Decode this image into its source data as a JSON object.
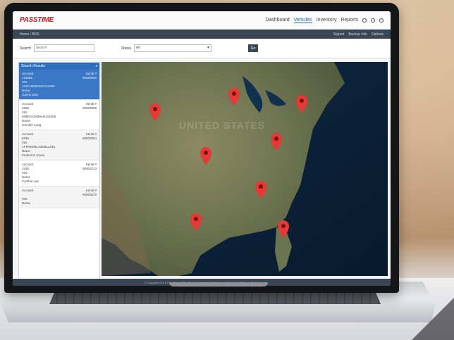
{
  "app": {
    "logo_prefix": "PASS",
    "logo_suffix": "TIME",
    "nav": [
      {
        "label": "Dashboard",
        "active": false
      },
      {
        "label": "Vehicles",
        "active": true
      },
      {
        "label": "Inventory",
        "active": false
      },
      {
        "label": "Reports",
        "active": false
      }
    ],
    "nav_icons": [
      "settings-icon",
      "user-icon",
      "help-icon"
    ]
  },
  "subbar": {
    "left": "Home / BDS",
    "right": [
      "Signed",
      "Backup Info",
      "Options"
    ]
  },
  "filter": {
    "search_label": "Search",
    "search_placeholder": "Search",
    "status_label": "Status",
    "status_value": "All",
    "go_label": "Go"
  },
  "panel": {
    "title": "Search Results",
    "close": "x",
    "items": [
      {
        "a": "Account",
        "b": "Serial #",
        "c": "123456",
        "d": "00000000",
        "e": "VIN",
        "f": "1HGCM82633A123456",
        "g": "Name",
        "h": "Carlos Diaz"
      },
      {
        "a": "Account",
        "b": "Serial #",
        "c": "4568",
        "d": "00004008",
        "e": "VIN",
        "f": "5NMSG3AB9AH123456",
        "g": "Name",
        "h": "Jennifer Long"
      },
      {
        "a": "Account",
        "b": "Serial #",
        "c": "8765",
        "d": "00002054",
        "e": "VIN",
        "f": "1FTRW08LX3KB12345",
        "g": "Name",
        "h": "Frederick Jones"
      },
      {
        "a": "Account",
        "b": "Serial #",
        "c": "1045",
        "d": "00000213",
        "e": "VIN",
        "f": "",
        "g": "Name",
        "h": "Cynthia Lee"
      },
      {
        "a": "Account",
        "b": "Serial #",
        "c": "",
        "d": "00000870",
        "e": "VIN",
        "f": "",
        "g": "Name",
        "h": ""
      }
    ]
  },
  "map": {
    "watermark": "UNITED STATES",
    "pin_color": "#e53935"
  },
  "footer": "© Copyright 2016 PassTime GPS. All rights reserved. Terms and Conditions | Privacy Policy"
}
